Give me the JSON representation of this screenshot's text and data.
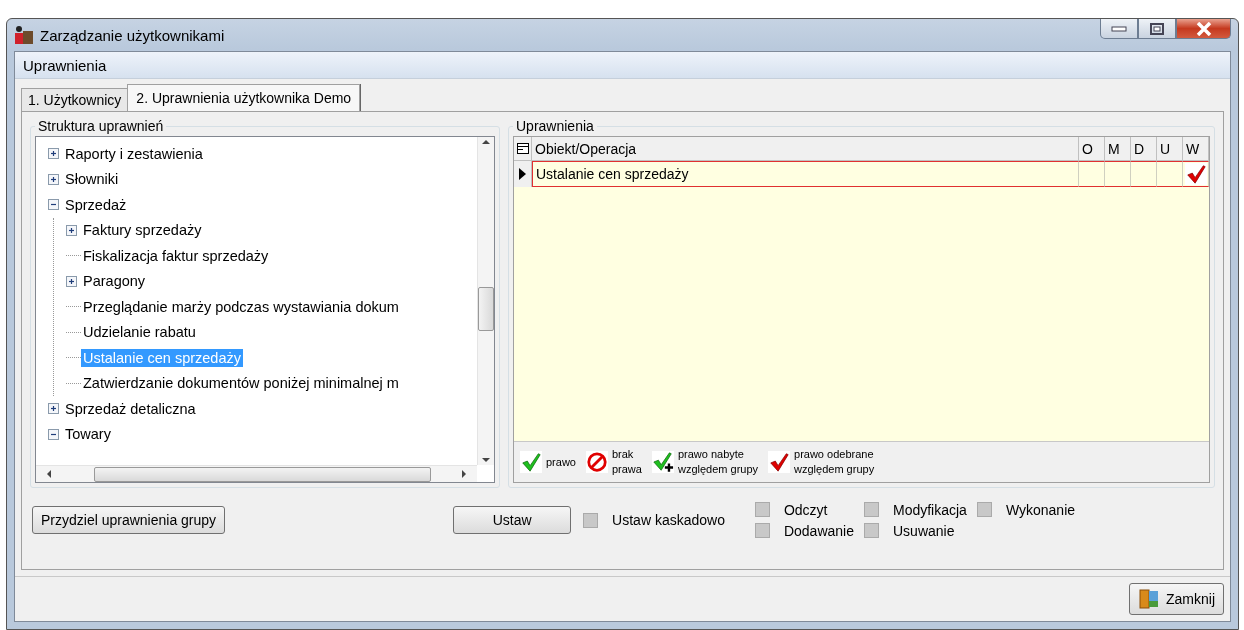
{
  "window": {
    "title": "Zarządzanie użytkownikami"
  },
  "menu": [
    {
      "label": "Uprawnienia"
    }
  ],
  "tabs": [
    {
      "label": "1. Użytkownicy",
      "selected": false
    },
    {
      "label": "2. Uprawnienia użytkownika Demo",
      "selected": true
    }
  ],
  "tree": {
    "title": "Struktura uprawnień",
    "items": [
      {
        "label": "Raporty i zestawienia",
        "kind": "node",
        "expanded": false,
        "selected": false
      },
      {
        "label": "Słowniki",
        "kind": "node",
        "expanded": false,
        "selected": false
      },
      {
        "label": "Sprzedaż",
        "kind": "node",
        "expanded": true,
        "selected": false,
        "children": [
          {
            "label": "Faktury sprzedaży",
            "kind": "node",
            "expanded": false,
            "selected": false
          },
          {
            "label": "Fiskalizacja faktur sprzedaży",
            "kind": "leaf",
            "selected": false
          },
          {
            "label": "Paragony",
            "kind": "node",
            "expanded": false,
            "selected": false
          },
          {
            "label": "Przeglądanie marży podczas wystawiania dokum",
            "kind": "leaf",
            "selected": false
          },
          {
            "label": "Udzielanie rabatu",
            "kind": "leaf",
            "selected": false
          },
          {
            "label": "Ustalanie cen sprzedaży",
            "kind": "leaf",
            "selected": true
          },
          {
            "label": "Zatwierdzanie dokumentów poniżej minimalnej m",
            "kind": "leaf",
            "selected": false
          }
        ]
      },
      {
        "label": "Sprzedaż detaliczna",
        "kind": "node",
        "expanded": false,
        "selected": false
      },
      {
        "label": "Towary",
        "kind": "node",
        "expanded": true,
        "selected": false
      }
    ]
  },
  "permissions": {
    "title": "Uprawnienia",
    "columns": [
      "Obiekt/Operacja",
      "O",
      "M",
      "D",
      "U",
      "W"
    ],
    "rows": [
      {
        "name": "Ustalanie cen sprzedaży",
        "selected": true,
        "cells": [
          {
            "kind": "empty"
          },
          {
            "kind": "empty"
          },
          {
            "kind": "empty"
          },
          {
            "kind": "empty"
          },
          {
            "kind": "revoked_group"
          }
        ]
      }
    ],
    "legend": [
      {
        "kind": "granted",
        "lines": [
          "prawo"
        ]
      },
      {
        "kind": "denied",
        "lines": [
          "brak",
          "prawa"
        ]
      },
      {
        "kind": "granted_group",
        "lines": [
          "prawo nabyte",
          "względem grupy"
        ]
      },
      {
        "kind": "revoked_group",
        "lines": [
          "prawo odebrane",
          "względem grupy"
        ]
      }
    ]
  },
  "actions": {
    "assign_button": "Przydziel uprawnienia grupy",
    "set_button": "Ustaw",
    "cascade": {
      "label": "Ustaw kaskadowo",
      "checked": false
    },
    "operations": [
      {
        "label": "Odczyt",
        "checked": false
      },
      {
        "label": "Modyfikacja",
        "checked": false
      },
      {
        "label": "Wykonanie",
        "checked": false
      },
      {
        "label": "Dodawanie",
        "checked": false
      },
      {
        "label": "Usuwanie",
        "checked": false
      }
    ]
  },
  "footer": {
    "close_button": "Zamknij"
  }
}
